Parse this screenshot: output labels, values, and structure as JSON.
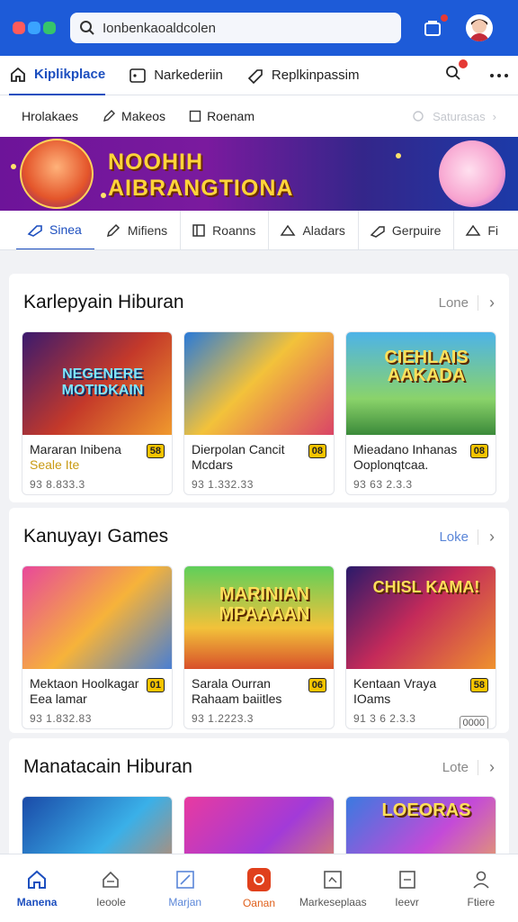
{
  "search": {
    "placeholder": "Ionbenkaoaldcolen"
  },
  "nav": {
    "items": [
      {
        "label": "Kiplikplace",
        "icon": "home-icon"
      },
      {
        "label": "Narkederiin",
        "icon": "play-icon"
      },
      {
        "label": "Replkinpassim",
        "icon": "tag-icon"
      }
    ]
  },
  "subrow": {
    "items": [
      "Hrolakaes",
      "Makeos",
      "Roenam"
    ],
    "faded": "Saturasas"
  },
  "banner": {
    "line1": "NOOHIH",
    "line2": "AIBRANGTIONA"
  },
  "categories": [
    "Sinea",
    "Mifiens",
    "Roanns",
    "Aladars",
    "Gerpuire",
    "Fi"
  ],
  "sections": [
    {
      "title": "Karlepyain Hiburan",
      "more": "Lone",
      "cards": [
        {
          "thumb_text": "NEGENERE\nMOTIDKAIN",
          "title": "Mararan Inibena",
          "subtitle": "Seale Ite",
          "meta": "93 8.833.3",
          "tag": "58"
        },
        {
          "thumb_text": "",
          "title": "Dierpolan Cancit Mcdars",
          "subtitle": "",
          "meta": "93 1.332.33",
          "tag": "08"
        },
        {
          "thumb_text": "CIEHLAIS\nAAKADA",
          "title": "Mieadano Inhanas Ooplonqtcaa.",
          "subtitle": "",
          "meta": "93 63 2.3.3",
          "tag": "08"
        }
      ]
    },
    {
      "title": "Kanuyayı Games",
      "more": "Loke",
      "cards": [
        {
          "thumb_text": "",
          "title": "Mektaon Hoolkagar",
          "subtitle": "Eea lamar",
          "meta": "93 1.832.83",
          "tag": "01"
        },
        {
          "thumb_text": "MARINIAN\nMPAAAAN",
          "title": "Sarala Ourran",
          "subtitle": "Rahaam baiitles",
          "meta": "93 1.2223.3",
          "tag": "06"
        },
        {
          "thumb_text": "CHISL  KAMA!",
          "title": "Kentaan Vraya",
          "subtitle": "IOams",
          "meta": "91 3 6 2.3.3",
          "tag": "58",
          "tag2": "0000"
        }
      ]
    },
    {
      "title": "Manatacain Hiburan",
      "more": "Lote",
      "cards": [
        {
          "thumb_text": ""
        },
        {
          "thumb_text": ""
        },
        {
          "thumb_text": "LOEORAS"
        }
      ]
    }
  ],
  "bottom_nav": [
    "Manena",
    "Ieoole",
    "Marjan",
    "Oanan",
    "Markeseplaas",
    "Ieevr",
    "Ftiere"
  ],
  "colors": {
    "brand": "#1d5bd8",
    "accent": "#1d4fbf",
    "badge": "#e53935"
  }
}
